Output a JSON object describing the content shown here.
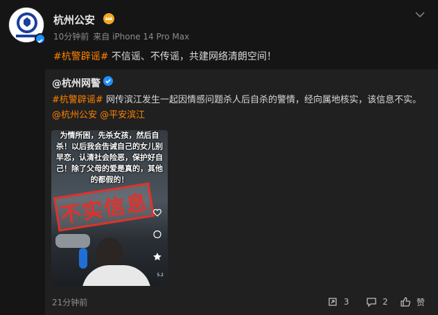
{
  "post": {
    "author": "杭州公安",
    "time": "10分钟前",
    "source": "来自 iPhone 14 Pro Max",
    "hashtag": "#杭警辟谣#",
    "text": "不信谣、不传谣，共建网络清朗空间！"
  },
  "repost": {
    "author": "@杭州网警",
    "hashtag": "#杭警辟谣#",
    "text": "网传滨江发生一起因情感问题杀人后自杀的警情，经向属地核实，该信息不实。",
    "mention1": "@杭州公安",
    "mention2": "@平安滨江",
    "video": {
      "caption": "为情所困，先杀女孩，然后自杀！以后我会告诫自己的女儿别早恋，认清社会险恶，保护好自己！除了父母的爱是真的，其他的都假的！",
      "stamp": "不实信息",
      "count": "5.2"
    },
    "time": "21分钟前",
    "reposts": "3",
    "comments": "2",
    "like_label": "赞"
  },
  "icons": {
    "avatar": "police-emblem-icon",
    "verified": "verified-badge-icon",
    "vip": "vip-crown-icon",
    "more": "chevron-down-icon",
    "repost": "repost-icon",
    "comment": "comment-icon",
    "like": "like-icon"
  },
  "colors": {
    "accent": "#ff8200",
    "verified": "#1f8fff",
    "stamp": "#e0312b",
    "background": "#151515",
    "card": "#202020"
  }
}
